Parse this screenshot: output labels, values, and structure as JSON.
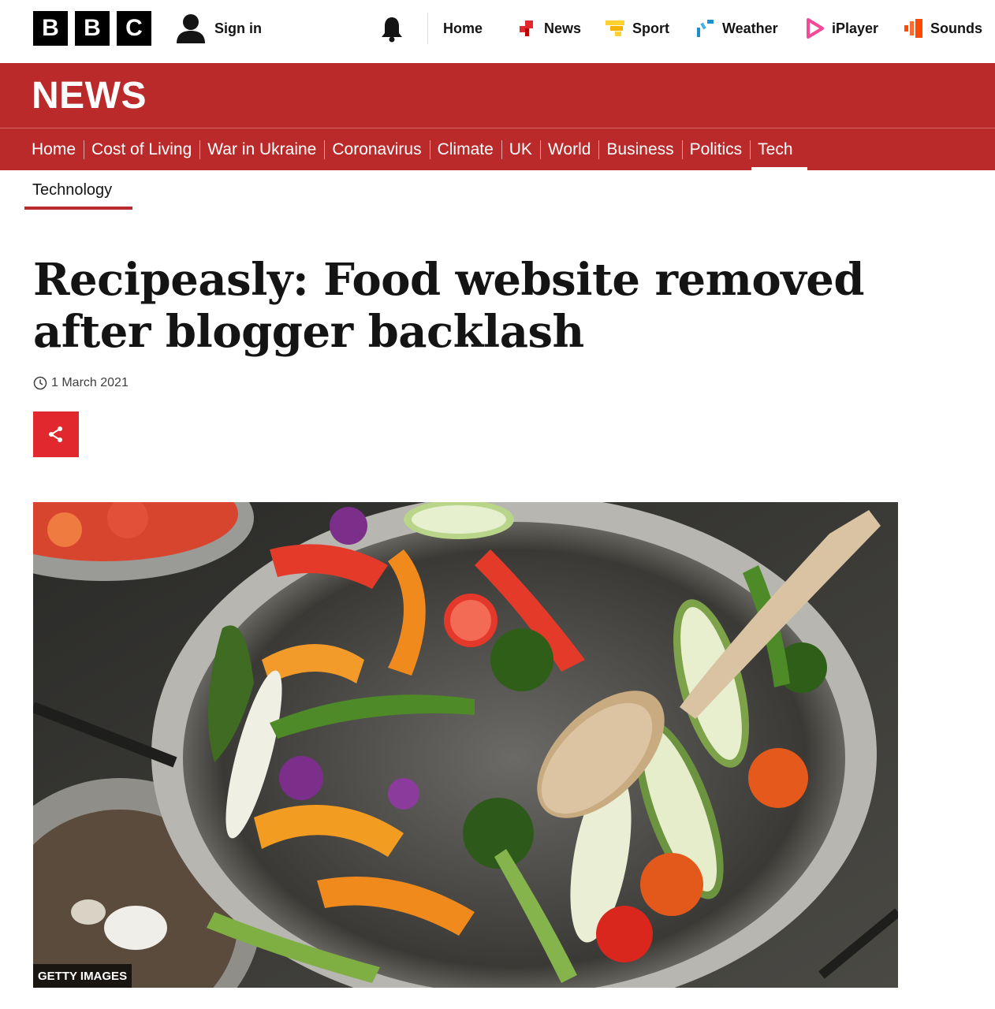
{
  "masthead": {
    "logo_letters": [
      "B",
      "B",
      "C"
    ],
    "signin_label": "Sign in",
    "nav": [
      {
        "label": "Home",
        "icon": "none"
      },
      {
        "label": "News",
        "icon": "news-icon",
        "color": "#e0282e"
      },
      {
        "label": "Sport",
        "icon": "sport-icon",
        "color": "#ffd230"
      },
      {
        "label": "Weather",
        "icon": "weather-icon",
        "color": "#1f8ecf"
      },
      {
        "label": "iPlayer",
        "icon": "iplayer-icon",
        "color": "#f54997"
      },
      {
        "label": "Sounds",
        "icon": "sounds-icon",
        "color": "#ff4800"
      }
    ]
  },
  "news": {
    "title": "NEWS",
    "nav": [
      "Home",
      "Cost of Living",
      "War in Ukraine",
      "Coronavirus",
      "Climate",
      "UK",
      "World",
      "Business",
      "Politics",
      "Tech"
    ],
    "active": "Tech"
  },
  "subnav": {
    "label": "Technology"
  },
  "article": {
    "headline": "Recipeasly: Food website removed after blogger backlash",
    "date": "1 March 2021",
    "image_credit": "GETTY IMAGES"
  },
  "colors": {
    "brand_red": "#bb2a2a",
    "share_red": "#e0282e"
  }
}
